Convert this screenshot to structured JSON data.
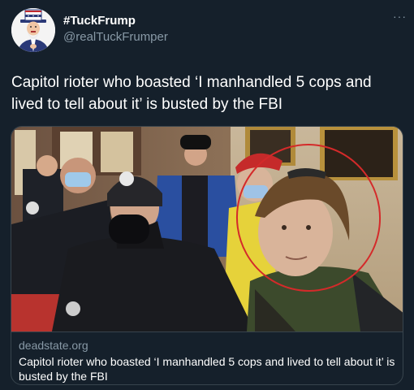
{
  "tweet": {
    "display_name": "#TuckFrump",
    "handle": "@realTuckFrumper",
    "more_label": "···",
    "text": "Capitol rioter who boasted ‘I manhandled 5 cops and lived to tell about it’ is busted by the FBI"
  },
  "card": {
    "domain": "deadstate.org",
    "title": "Capitol rioter who boasted ‘I manhandled 5 cops and lived to tell about it’ is busted by the FBI"
  },
  "icons": {
    "avatar": "uncle-sam-caricature-avatar",
    "more": "more-options-icon"
  },
  "colors": {
    "background": "#15202b",
    "primary_text": "#ffffff",
    "secondary_text": "#8899a6",
    "border": "#38444d",
    "annotation_circle": "#d42a2a"
  }
}
